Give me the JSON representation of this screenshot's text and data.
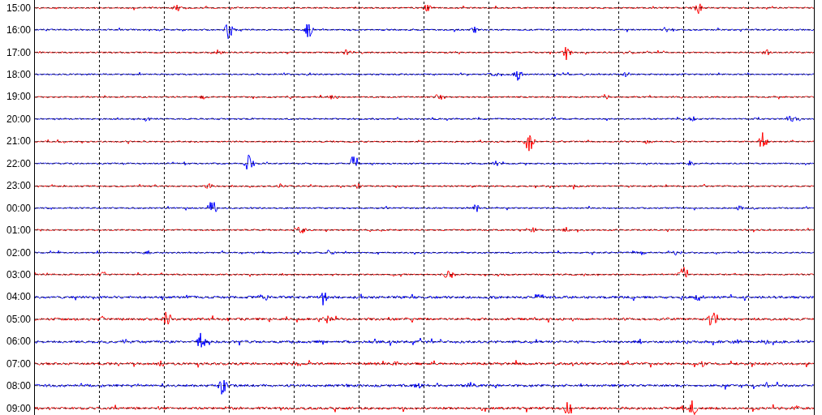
{
  "traces": [
    {
      "time": "15:00",
      "color": "#ff0000"
    },
    {
      "time": "16:00",
      "color": "#0000ff"
    },
    {
      "time": "17:00",
      "color": "#ff0000"
    },
    {
      "time": "18:00",
      "color": "#0000ff"
    },
    {
      "time": "19:00",
      "color": "#ff0000"
    },
    {
      "time": "20:00",
      "color": "#0000ff"
    },
    {
      "time": "21:00",
      "color": "#ff0000"
    },
    {
      "time": "22:00",
      "color": "#0000ff"
    },
    {
      "time": "23:00",
      "color": "#ff0000"
    },
    {
      "time": "00:00",
      "color": "#0000ff"
    },
    {
      "time": "01:00",
      "color": "#ff0000"
    },
    {
      "time": "02:00",
      "color": "#0000ff"
    },
    {
      "time": "03:00",
      "color": "#ff0000"
    },
    {
      "time": "04:00",
      "color": "#0000ff"
    },
    {
      "time": "05:00",
      "color": "#ff0000"
    },
    {
      "time": "06:00",
      "color": "#0000ff"
    },
    {
      "time": "07:00",
      "color": "#ff0000"
    },
    {
      "time": "08:00",
      "color": "#0000ff"
    },
    {
      "time": "09:00",
      "color": "#ff0000"
    }
  ]
}
